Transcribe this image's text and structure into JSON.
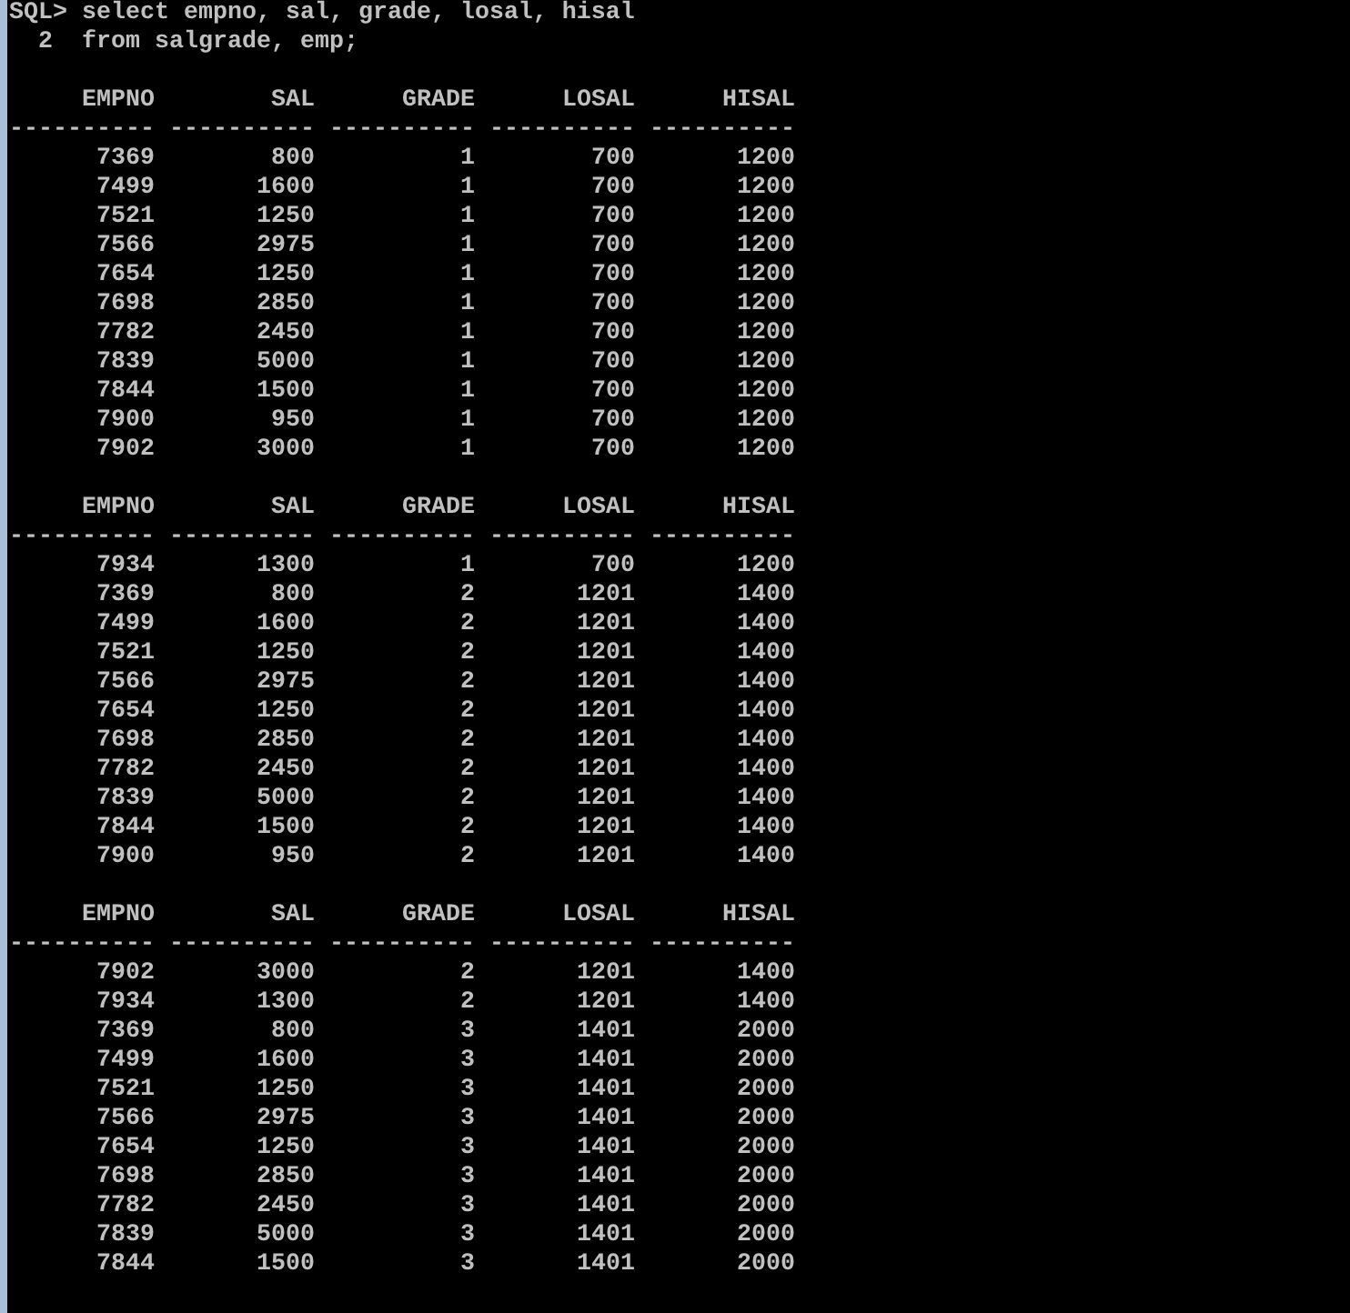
{
  "console_lines": [
    "SQL> select empno, sal, grade, losal, hisal",
    "  2  from salgrade, emp;"
  ],
  "result_pages": [
    {
      "columns": [
        {
          "heading": "EMPNO",
          "underline": "----------"
        },
        {
          "heading": "SAL",
          "underline": "----------"
        },
        {
          "heading": "GRADE",
          "underline": "----------"
        },
        {
          "heading": "LOSAL",
          "underline": "----------"
        },
        {
          "heading": "HISAL",
          "underline": "----------"
        }
      ],
      "rows": [
        [
          "7369",
          "800",
          "1",
          "700",
          "1200"
        ],
        [
          "7499",
          "1600",
          "1",
          "700",
          "1200"
        ],
        [
          "7521",
          "1250",
          "1",
          "700",
          "1200"
        ],
        [
          "7566",
          "2975",
          "1",
          "700",
          "1200"
        ],
        [
          "7654",
          "1250",
          "1",
          "700",
          "1200"
        ],
        [
          "7698",
          "2850",
          "1",
          "700",
          "1200"
        ],
        [
          "7782",
          "2450",
          "1",
          "700",
          "1200"
        ],
        [
          "7839",
          "5000",
          "1",
          "700",
          "1200"
        ],
        [
          "7844",
          "1500",
          "1",
          "700",
          "1200"
        ],
        [
          "7900",
          "950",
          "1",
          "700",
          "1200"
        ],
        [
          "7902",
          "3000",
          "1",
          "700",
          "1200"
        ]
      ]
    },
    {
      "columns": [
        {
          "heading": "EMPNO",
          "underline": "----------"
        },
        {
          "heading": "SAL",
          "underline": "----------"
        },
        {
          "heading": "GRADE",
          "underline": "----------"
        },
        {
          "heading": "LOSAL",
          "underline": "----------"
        },
        {
          "heading": "HISAL",
          "underline": "----------"
        }
      ],
      "rows": [
        [
          "7934",
          "1300",
          "1",
          "700",
          "1200"
        ],
        [
          "7369",
          "800",
          "2",
          "1201",
          "1400"
        ],
        [
          "7499",
          "1600",
          "2",
          "1201",
          "1400"
        ],
        [
          "7521",
          "1250",
          "2",
          "1201",
          "1400"
        ],
        [
          "7566",
          "2975",
          "2",
          "1201",
          "1400"
        ],
        [
          "7654",
          "1250",
          "2",
          "1201",
          "1400"
        ],
        [
          "7698",
          "2850",
          "2",
          "1201",
          "1400"
        ],
        [
          "7782",
          "2450",
          "2",
          "1201",
          "1400"
        ],
        [
          "7839",
          "5000",
          "2",
          "1201",
          "1400"
        ],
        [
          "7844",
          "1500",
          "2",
          "1201",
          "1400"
        ],
        [
          "7900",
          "950",
          "2",
          "1201",
          "1400"
        ]
      ]
    },
    {
      "columns": [
        {
          "heading": "EMPNO",
          "underline": "----------"
        },
        {
          "heading": "SAL",
          "underline": "----------"
        },
        {
          "heading": "GRADE",
          "underline": "----------"
        },
        {
          "heading": "LOSAL",
          "underline": "----------"
        },
        {
          "heading": "HISAL",
          "underline": "----------"
        }
      ],
      "rows": [
        [
          "7902",
          "3000",
          "2",
          "1201",
          "1400"
        ],
        [
          "7934",
          "1300",
          "2",
          "1201",
          "1400"
        ],
        [
          "7369",
          "800",
          "3",
          "1401",
          "2000"
        ],
        [
          "7499",
          "1600",
          "3",
          "1401",
          "2000"
        ],
        [
          "7521",
          "1250",
          "3",
          "1401",
          "2000"
        ],
        [
          "7566",
          "2975",
          "3",
          "1401",
          "2000"
        ],
        [
          "7654",
          "1250",
          "3",
          "1401",
          "2000"
        ],
        [
          "7698",
          "2850",
          "3",
          "1401",
          "2000"
        ],
        [
          "7782",
          "2450",
          "3",
          "1401",
          "2000"
        ],
        [
          "7839",
          "5000",
          "3",
          "1401",
          "2000"
        ],
        [
          "7844",
          "1500",
          "3",
          "1401",
          "2000"
        ]
      ]
    }
  ]
}
